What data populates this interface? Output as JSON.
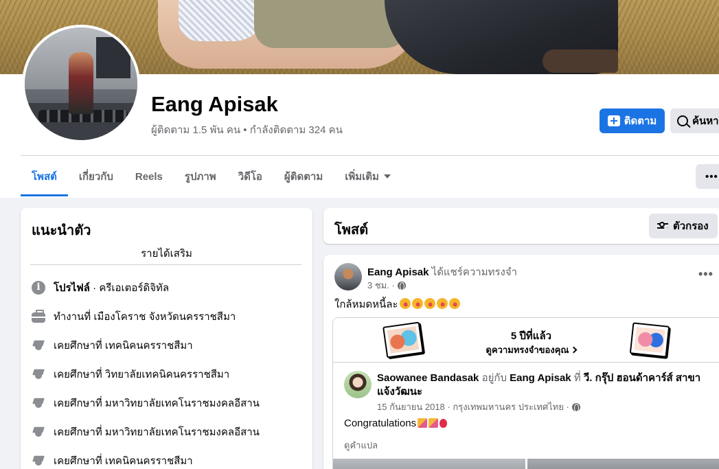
{
  "profile": {
    "name": "Eang Apisak",
    "followers_text": "ผู้ติดตาม 1.5 พัน คน • กำลังติดตาม 324 คน",
    "follow_label": "ติดตาม",
    "search_label": "ค้นหา"
  },
  "tabs": [
    {
      "label": "โพสต์"
    },
    {
      "label": "เกี่ยวกับ"
    },
    {
      "label": "Reels"
    },
    {
      "label": "รูปภาพ"
    },
    {
      "label": "วิดีโอ"
    },
    {
      "label": "ผู้ติดตาม"
    },
    {
      "label": "เพิ่มเติม"
    }
  ],
  "more_dots": "•••",
  "intro": {
    "title": "แนะนำตัว",
    "subtitle": "รายได้เสริม",
    "items": [
      {
        "icon": "info-icon",
        "bold": "โปรไฟล์",
        "text": " · ครีเอเตอร์ดิจิทัล"
      },
      {
        "icon": "briefcase-icon",
        "text": "ทำงานที่ เมืองโคราช จังหวัดนครราชสีมา"
      },
      {
        "icon": "graduation-cap-icon",
        "text": "เคยศึกษาที่ เทคนิคนครราชสีมา"
      },
      {
        "icon": "graduation-cap-icon",
        "text": "เคยศึกษาที่ วิทยาลัยเทคนิคนครราชสีมา"
      },
      {
        "icon": "graduation-cap-icon",
        "text": "เคยศึกษาที่ มหาวิทยาลัยเทคโนราชมงคลอีสาน"
      },
      {
        "icon": "graduation-cap-icon",
        "text": "เคยศึกษาที่ มหาวิทยาลัยเทคโนราชมงคลอีสาน"
      },
      {
        "icon": "graduation-cap-icon",
        "text": "เคยศึกษาที่ เทคนิคนครราชสีมา"
      }
    ]
  },
  "posts_header": {
    "title": "โพสต์",
    "filter_label": "ตัวกรอง"
  },
  "post": {
    "author": "Eang Apisak",
    "action": " ได้แชร์ความทรงจำ",
    "time": "3 ชม. ·",
    "text": "ใกล้หมดหนี้ละ",
    "memory": {
      "years": "5 ปีที่แล้ว",
      "link": "ดูความทรงจำของคุณ"
    },
    "shared": {
      "author": "Saowanee Bandasak",
      "with_word": " อยู่กับ ",
      "with_name": "Eang Apisak",
      "at_word": " ที่ ",
      "place": "วี. กรุ๊ป ฮอนด้าคาร์ส์ สาขาแจ้งวัฒนะ",
      "time": "15 กันยายน 2018 · กรุงเทพมหานคร ประเทศไทย ·",
      "text": "Congratulations",
      "translate": "ดูคำแปล"
    }
  }
}
